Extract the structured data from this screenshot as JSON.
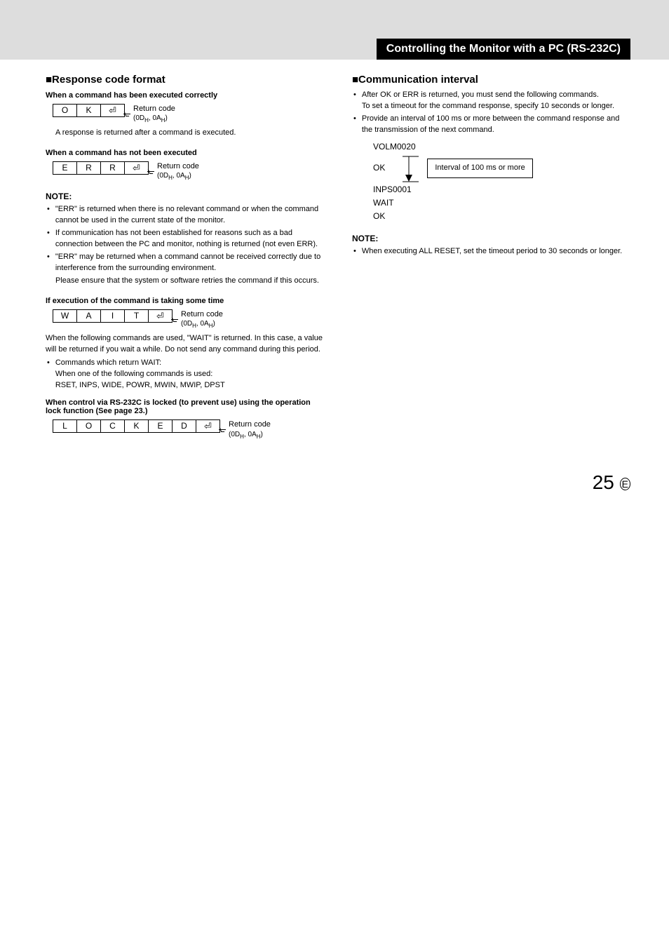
{
  "header": {
    "title": "Controlling the Monitor with a PC (RS-232C)"
  },
  "left": {
    "section_title": "■Response code format",
    "sub1": "When a command has been executed correctly",
    "ok_cells": [
      "O",
      "K",
      "⏎"
    ],
    "rc_label": "Return code",
    "rc_hex": "(0DH, 0AH)",
    "ok_desc": "A response is returned after a command is executed.",
    "sub2": "When a command has not been executed",
    "err_cells": [
      "E",
      "R",
      "R",
      "⏎"
    ],
    "note_head": "NOTE:",
    "note_items": [
      "\"ERR\" is returned when there is no relevant command or when the command cannot be used in the current state of the monitor.",
      "If communication has not been established for reasons such as a bad connection between the PC and monitor, nothing is returned (not even ERR).",
      "\"ERR\" may be returned when a command cannot be received correctly due to interference from the surrounding environment."
    ],
    "note_trailer": "Please ensure that the system or software retries the command if this occurs.",
    "sub3": "If execution of the command is taking some time",
    "wait_cells": [
      "W",
      "A",
      "I",
      "T",
      "⏎"
    ],
    "wait_para": "When the following commands are used, \"WAIT\" is returned. In this case, a value will be returned if you wait a while. Do not send any command during this period.",
    "wait_list_head": "Commands which return WAIT:",
    "wait_list_line1": "When one of the following commands is used:",
    "wait_list_line2": "RSET, INPS, WIDE, POWR, MWIN, MWIP, DPST",
    "sub4": "When control via RS-232C is locked (to prevent use) using the operation lock function (See page 23.)",
    "locked_cells": [
      "L",
      "O",
      "C",
      "K",
      "E",
      "D",
      "⏎"
    ]
  },
  "right": {
    "section_title": "■Communication interval",
    "items": [
      "After OK or ERR is returned, you must send the following commands.",
      "Provide an interval of 100 ms or more between the command response and the transmission of the next command."
    ],
    "item1_trailer": "To set a timeout for the command response, specify 10 seconds or longer.",
    "interval": {
      "l1": "VOLM0020",
      "l2": "OK",
      "label": "Interval of 100 ms or more",
      "l3": "INPS0001",
      "l4": "WAIT",
      "l5": "OK"
    },
    "note_head": "NOTE:",
    "note_items": [
      "When executing ALL RESET, set the timeout period to 30 seconds or longer."
    ]
  },
  "page": {
    "num": "25",
    "suffix": "E"
  }
}
